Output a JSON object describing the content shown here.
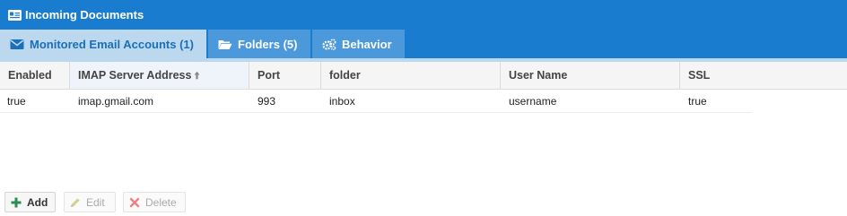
{
  "window": {
    "title": "Incoming Documents"
  },
  "tabs": [
    {
      "label": "Monitored Email Accounts (1)",
      "active": true
    },
    {
      "label": "Folders (5)",
      "active": false
    },
    {
      "label": "Behavior",
      "active": false
    }
  ],
  "grid": {
    "columns": [
      "Enabled",
      "IMAP Server Address",
      "Port",
      "folder",
      "User Name",
      "SSL"
    ],
    "sorted_column": "IMAP Server Address",
    "sort_direction": "ascending",
    "rows": [
      [
        "true",
        "imap.gmail.com",
        "993",
        "inbox",
        "username",
        "true"
      ]
    ]
  },
  "toolbar": {
    "add_label": "Add",
    "edit_label": "Edit",
    "delete_label": "Delete"
  },
  "colors": {
    "header_blue": "#1a7ccf",
    "active_tab": "#bcd8ee",
    "inactive_tab": "#4b99db",
    "add_green": "#2e8b57",
    "delete_red": "#e05050"
  }
}
